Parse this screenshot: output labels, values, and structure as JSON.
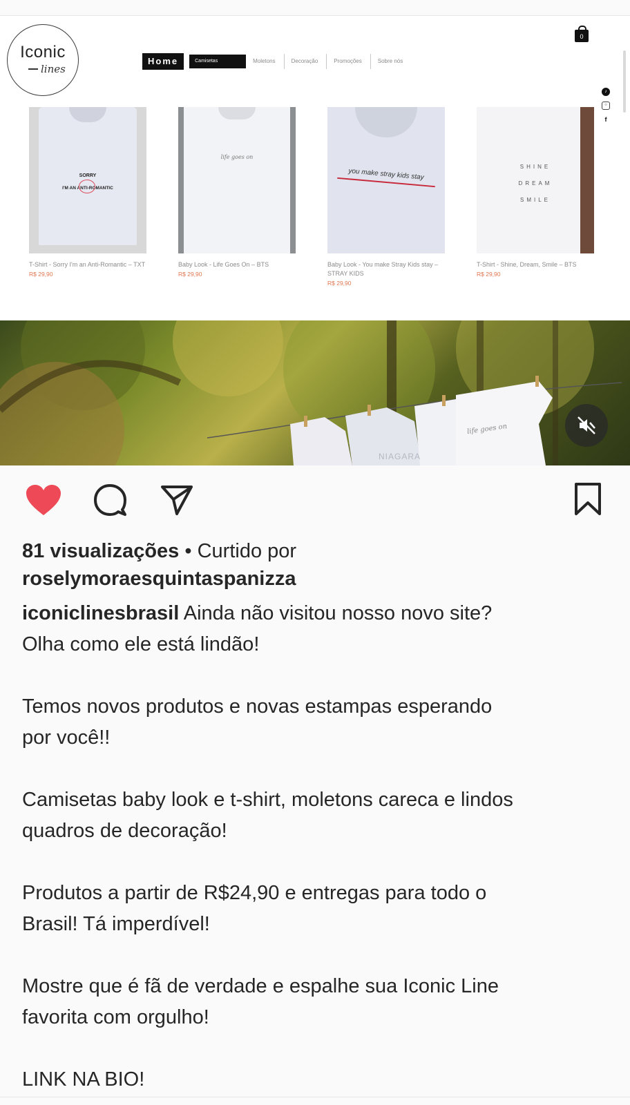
{
  "website": {
    "logo": {
      "main": "Iconic",
      "sub": "lines"
    },
    "nav": {
      "home": "Home",
      "active": "Camisetas",
      "items": [
        "Moletons",
        "Decoração",
        "Promoções",
        "Sobre nós"
      ]
    },
    "cart_count": "0",
    "social_icons": [
      "tiktok-icon",
      "instagram-icon",
      "facebook-icon"
    ],
    "products": [
      {
        "title": "T-Shirt - Sorry I'm an Anti-Romantic – TXT",
        "price": "R$ 29,90",
        "print_line1": "SORRY",
        "print_line2": "I'M AN ANTI-ROMANTIC"
      },
      {
        "title": "Baby Look - Life Goes On – BTS",
        "price": "R$ 29,90",
        "print_line1": "life goes on"
      },
      {
        "title": "Baby Look - You make Stray Kids stay – STRAY KIDS",
        "price": "R$ 29,90",
        "print_line1": "you make stray kids stay"
      },
      {
        "title": "T-Shirt - Shine, Dream, Smile – BTS",
        "price": "R$ 29,90",
        "print_line1": "SHINE",
        "print_line2": "DREAM",
        "print_line3": "SMILE"
      }
    ]
  },
  "media": {
    "shirt_prints": [
      "NIAGARA",
      "life goes on"
    ],
    "muted": true
  },
  "post": {
    "views": "81 visualizações",
    "liked_by_prefix": " • Curtido por",
    "liked_by_user": "roselymoraesquintaspanizza",
    "author": "iconiclinesbrasil",
    "caption_lines": [
      "Ainda não visitou nosso novo site?",
      "Olha como ele está lindão!",
      "",
      "Temos novos produtos e novas estampas esperando",
      "por você!!",
      "",
      "Camisetas baby look e t-shirt, moletons careca e lindos",
      "quadros de decoração!",
      "",
      "Produtos a partir de R$24,90 e entregas para todo o",
      "Brasil! Tá imperdível!",
      "",
      "Mostre que é fã de verdade e espalhe sua Iconic Line",
      "favorita com orgulho!",
      "",
      "LINK NA BIO!"
    ]
  },
  "colors": {
    "like": "#ed4956",
    "price": "#e0764f"
  }
}
